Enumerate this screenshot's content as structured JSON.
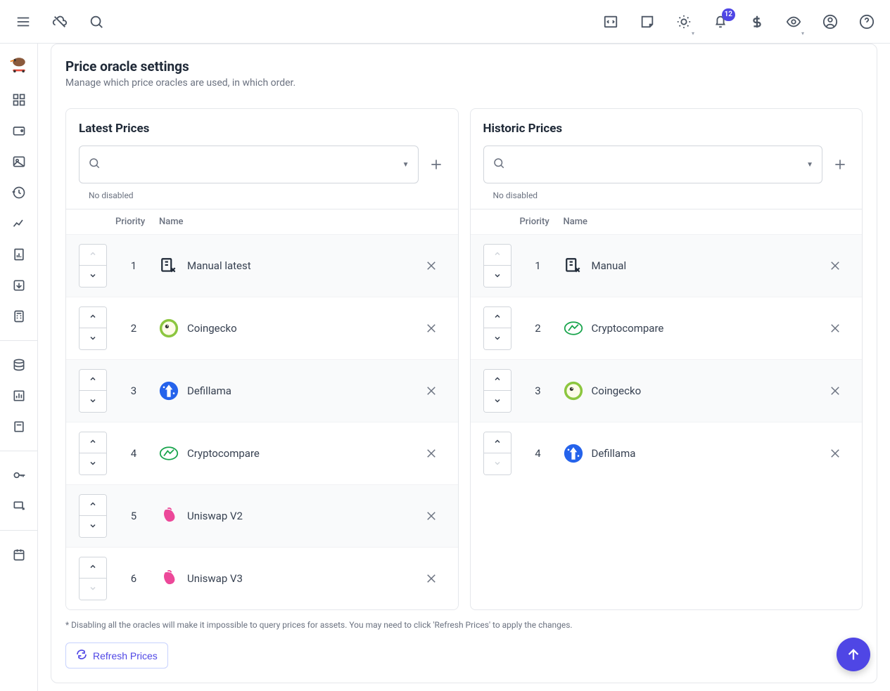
{
  "header": {
    "notification_count": "12"
  },
  "page": {
    "title": "Price oracle settings",
    "subtitle": "Manage which price oracles are used, in which order.",
    "footnote": "* Disabling all the oracles will make it impossible to query prices for assets. You may need to click 'Refresh Prices' to apply the changes.",
    "refresh_label": "Refresh Prices"
  },
  "columns": {
    "priority": "Priority",
    "name": "Name"
  },
  "hint_disabled": "No disabled",
  "latest": {
    "title": "Latest Prices",
    "items": [
      {
        "priority": "1",
        "name": "Manual latest",
        "icon": "manual"
      },
      {
        "priority": "2",
        "name": "Coingecko",
        "icon": "coingecko"
      },
      {
        "priority": "3",
        "name": "Defillama",
        "icon": "defillama"
      },
      {
        "priority": "4",
        "name": "Cryptocompare",
        "icon": "cryptocompare"
      },
      {
        "priority": "5",
        "name": "Uniswap V2",
        "icon": "uniswap"
      },
      {
        "priority": "6",
        "name": "Uniswap V3",
        "icon": "uniswap"
      }
    ]
  },
  "historic": {
    "title": "Historic Prices",
    "items": [
      {
        "priority": "1",
        "name": "Manual",
        "icon": "manual"
      },
      {
        "priority": "2",
        "name": "Cryptocompare",
        "icon": "cryptocompare"
      },
      {
        "priority": "3",
        "name": "Coingecko",
        "icon": "coingecko"
      },
      {
        "priority": "4",
        "name": "Defillama",
        "icon": "defillama"
      }
    ]
  }
}
